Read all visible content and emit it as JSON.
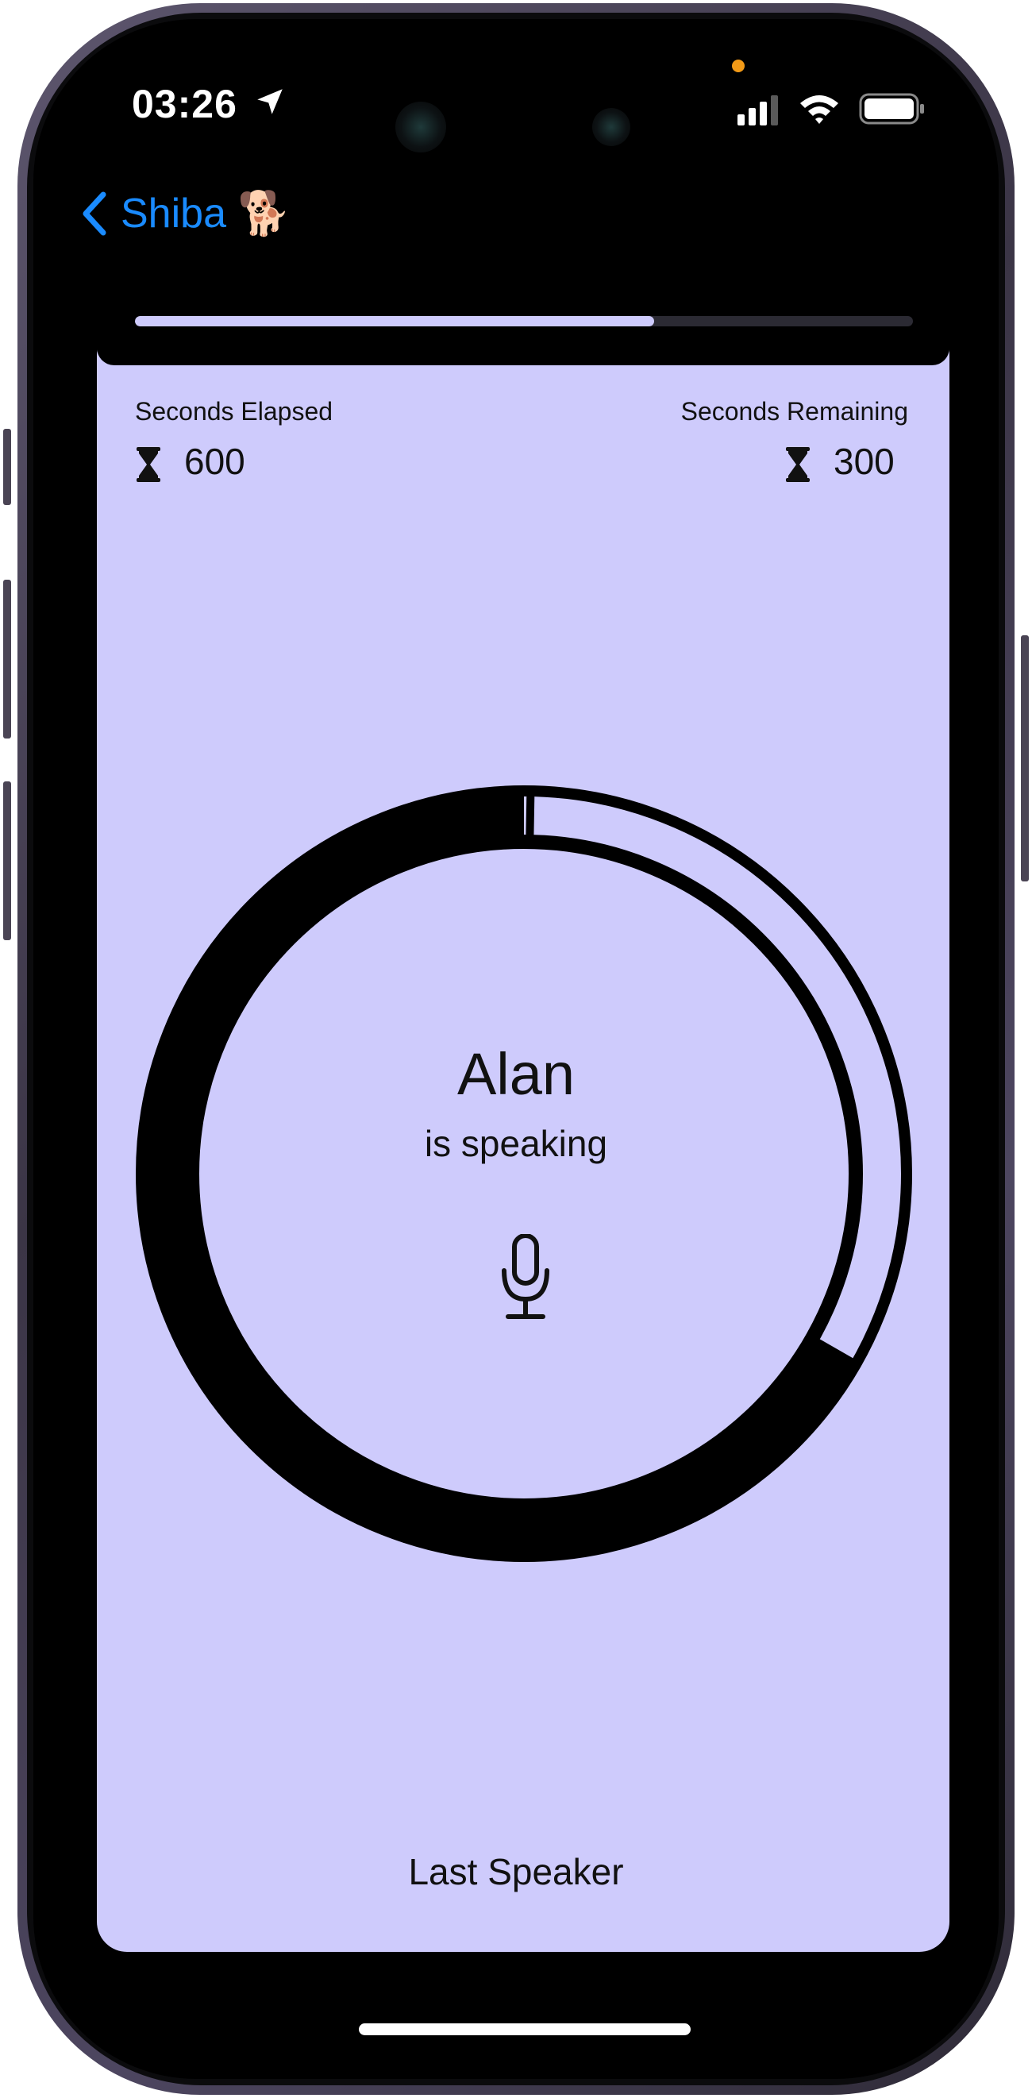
{
  "status_bar": {
    "time": "03:26",
    "location_icon": "location-arrow-icon",
    "signal_icon": "cellular-signal-icon",
    "wifi_icon": "wifi-icon",
    "battery_icon": "battery-icon"
  },
  "nav": {
    "back_label": "Shiba",
    "back_emoji": "🐕",
    "back_icon": "chevron-left-icon"
  },
  "meeting": {
    "progress_fraction": 0.667,
    "seconds_elapsed_label": "Seconds Elapsed",
    "seconds_elapsed": "600",
    "seconds_remaining_label": "Seconds Remaining",
    "seconds_remaining": "300",
    "speaker_name": "Alan",
    "speaker_status": "is speaking",
    "mic_icon": "microphone-icon",
    "footer_label": "Last Speaker",
    "ring_elapsed_fraction": 0.667
  },
  "colors": {
    "accent": "#1a8bff",
    "card_background": "#cecbfc",
    "screen_background": "#000000",
    "text": "#111111"
  }
}
